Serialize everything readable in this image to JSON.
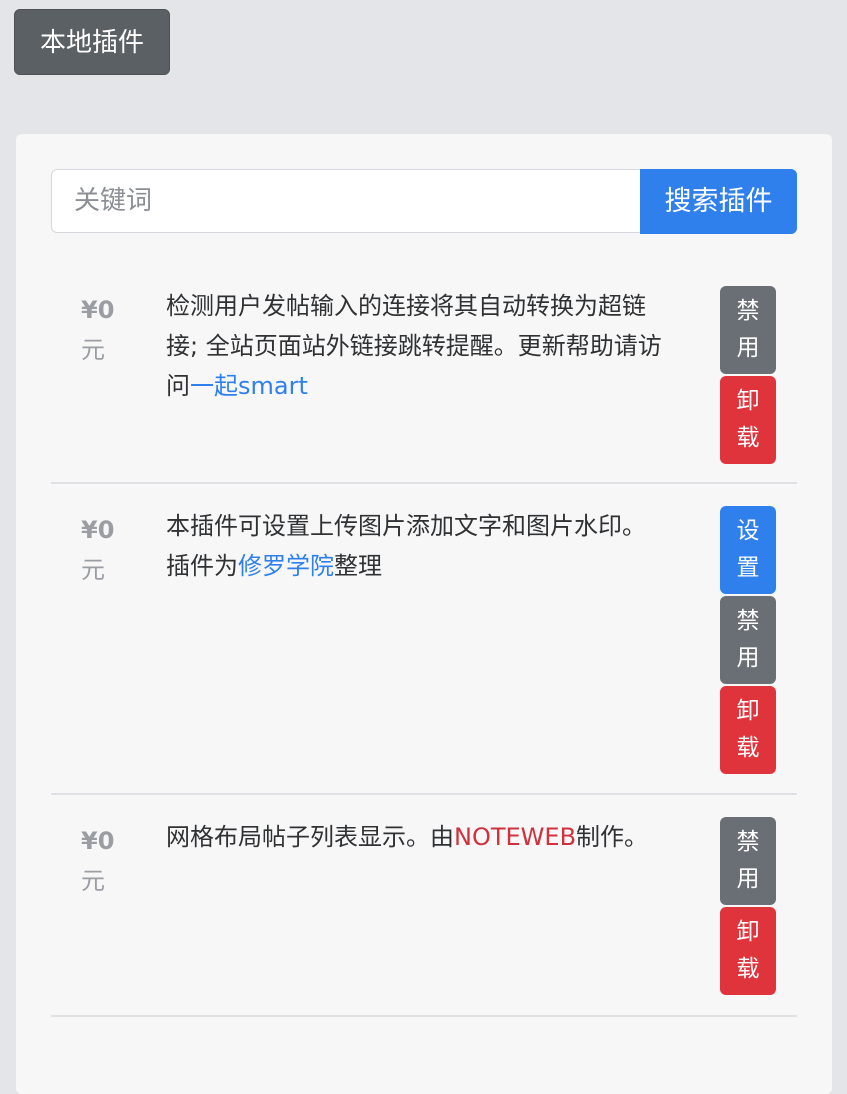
{
  "header": {
    "local_plugins_label": "本地插件"
  },
  "search": {
    "placeholder": "关键词",
    "button_label": "搜索插件"
  },
  "plugins": [
    {
      "price": "¥0",
      "price_unit": "元",
      "desc_text": "检测用户发帖输入的连接将其自动转换为超链接; 全站页面站外链接跳转提醒。更新帮助请访问",
      "link_text": "一起smart",
      "buttons": [
        {
          "l1": "禁",
          "l2": "用"
        },
        {
          "l1": "卸",
          "l2": "载"
        }
      ]
    },
    {
      "price": "¥0",
      "price_unit": "元",
      "desc_text": "本插件可设置上传图片添加文字和图片水印。",
      "desc_line2_pre": "插件为",
      "link_text": "修罗学院",
      "desc_line2_post": "整理",
      "buttons": [
        {
          "l1": "设",
          "l2": "置"
        },
        {
          "l1": "禁",
          "l2": "用"
        },
        {
          "l1": "卸",
          "l2": "载"
        }
      ]
    },
    {
      "price": "¥0",
      "price_unit": "元",
      "desc_pre": "网格布局帖子列表显示。由",
      "link_text": "NOTEWEB",
      "desc_post": "制作。",
      "buttons": [
        {
          "l1": "禁",
          "l2": "用"
        },
        {
          "l1": "卸",
          "l2": "载"
        }
      ]
    }
  ],
  "colors": {
    "primary": "#2f80ed",
    "secondary": "#6a6f75",
    "danger": "#e0343d"
  }
}
